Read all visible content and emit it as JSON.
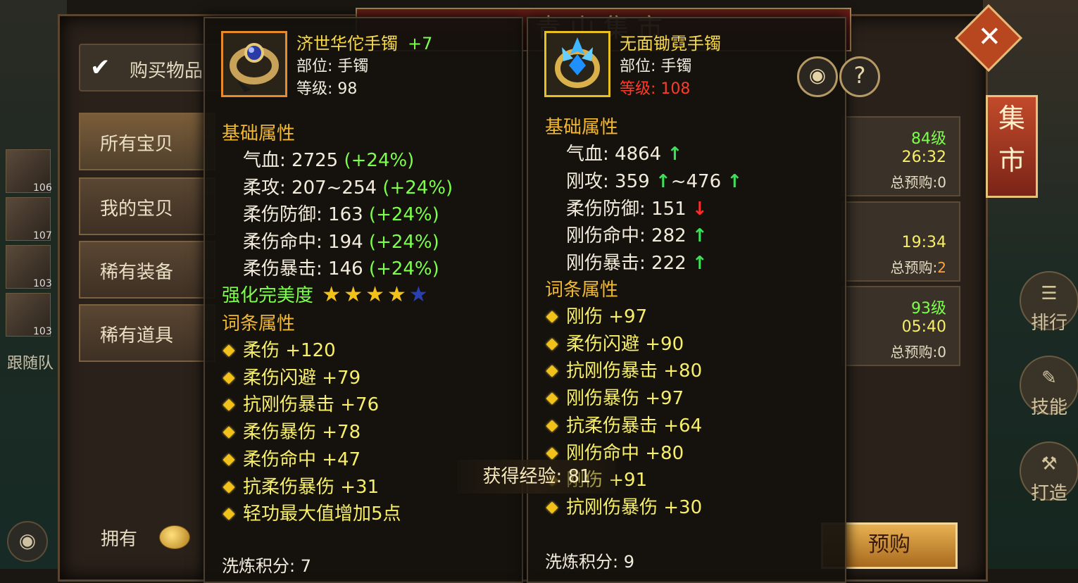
{
  "window": {
    "title": "青山集市"
  },
  "team": {
    "levels": [
      "106",
      "107",
      "103",
      "103"
    ],
    "follow_label": "跟随队"
  },
  "toolbar": {
    "buy_items_label": "购买物品"
  },
  "side_tabs": [
    {
      "label": "所有宝贝"
    },
    {
      "label": "我的宝贝"
    },
    {
      "label": "稀有装备"
    },
    {
      "label": "稀有道具"
    }
  ],
  "market_tab_label": "集市",
  "side_menu": [
    {
      "label": "排行",
      "icon": "ranking-icon"
    },
    {
      "label": "技能",
      "icon": "scroll-icon"
    },
    {
      "label": "打造",
      "icon": "hammer-icon"
    }
  ],
  "list_rows": [
    {
      "level": "84级",
      "time": "26:32",
      "presale_prefix": "总预购:",
      "presale_count": "0"
    },
    {
      "level": "",
      "time": "19:34",
      "presale_prefix": "总预购:",
      "presale_count": "2"
    },
    {
      "level": "93级",
      "time": "05:40",
      "presale_prefix": "总预购:",
      "presale_count": "0"
    }
  ],
  "footer": {
    "own_label": "拥有",
    "presale_button": "预购"
  },
  "left_item": {
    "name": "济世华佗手镯",
    "enhance": "+7",
    "slot": "部位: 手镯",
    "level": "等级: 98",
    "base_header": "基础属性",
    "base_stats": [
      {
        "label": "气血: 2725",
        "bonus": "(+24%)"
      },
      {
        "label": "柔攻: 207~254",
        "bonus": "(+24%)"
      },
      {
        "label": "柔伤防御: 163",
        "bonus": "(+24%)"
      },
      {
        "label": "柔伤命中: 194",
        "bonus": "(+24%)"
      },
      {
        "label": "柔伤暴击: 146",
        "bonus": "(+24%)"
      }
    ],
    "perfection_label": "强化完美度",
    "stars_filled": 4,
    "stars_total": 5,
    "affix_header": "词条属性",
    "affixes": [
      "柔伤 +120",
      "柔伤闪避 +79",
      "抗刚伤暴击 +76",
      "柔伤暴伤 +78",
      "柔伤命中 +47",
      "抗柔伤暴伤 +31",
      "轻功最大值增加5点"
    ],
    "refine": "洗炼积分: 7"
  },
  "right_item": {
    "name": "无面锄霓手镯",
    "slot": "部位: 手镯",
    "level": "等级: 108",
    "base_header": "基础属性",
    "base_stats": [
      {
        "label": "气血: 4864",
        "arrow": "↑"
      },
      {
        "label": "刚攻: 359",
        "arrow": "↑",
        "suffix": "~476",
        "arrow2": "↑"
      },
      {
        "label": "柔伤防御: 151",
        "arrow": "↓"
      },
      {
        "label": "刚伤命中: 282",
        "arrow": "↑"
      },
      {
        "label": "刚伤暴击: 222",
        "arrow": "↑"
      }
    ],
    "affix_header": "词条属性",
    "affixes": [
      "刚伤 +97",
      "柔伤闪避 +90",
      "抗刚伤暴击 +80",
      "刚伤暴伤 +97",
      "抗柔伤暴击 +64",
      "刚伤命中 +80",
      "刚伤 +91",
      "抗刚伤暴伤 +30"
    ],
    "refine": "洗炼积分: 9"
  },
  "exp_notice": {
    "label": "获得经验:",
    "value": "81"
  },
  "colors": {
    "gold_header": "#f2b830",
    "bonus_green": "#7cff4a",
    "affix_yellow": "#f7ef6a",
    "warn_red": "#ff3a2a"
  }
}
